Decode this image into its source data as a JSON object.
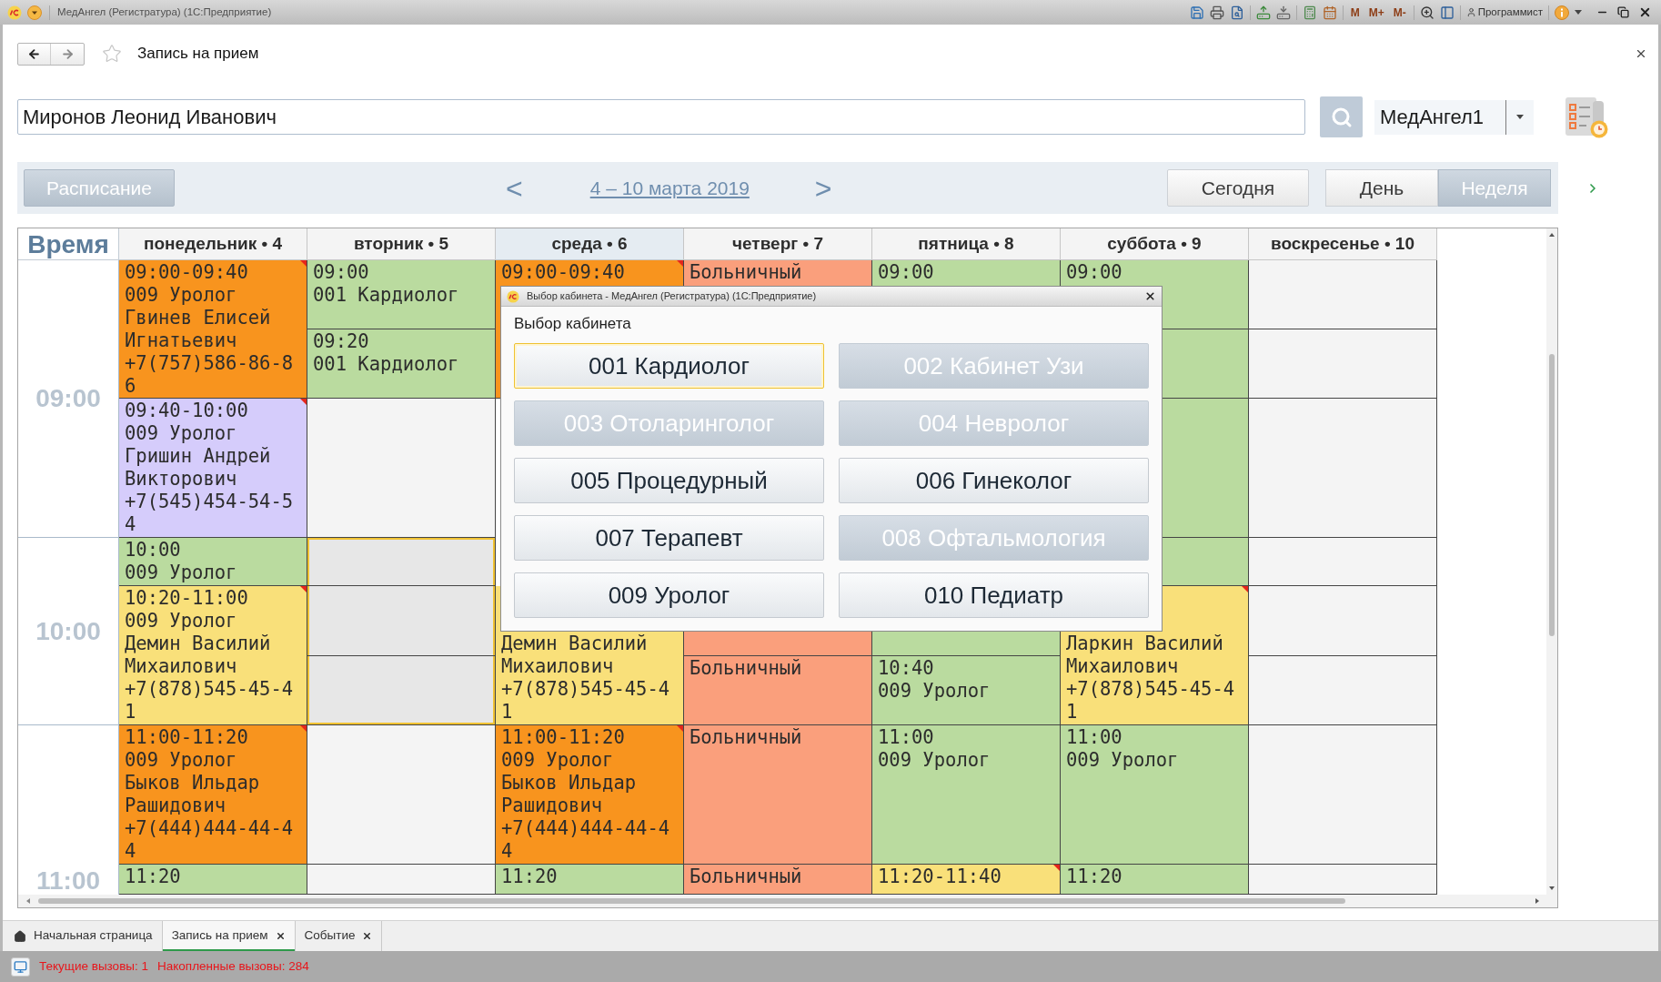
{
  "titlebar": {
    "title": "МедАнгел (Регистратура) (1С:Предприятие)",
    "memory_buttons": [
      "M",
      "M+",
      "M-"
    ],
    "user": "Программист"
  },
  "form": {
    "title": "Запись на прием",
    "favorite": false
  },
  "search": {
    "value": "Миронов Леонид Иванович"
  },
  "database": {
    "value": "МедАнгел1"
  },
  "toolbar": {
    "schedule_button": {
      "label": "Расписание",
      "pressed": true
    },
    "prev": "<",
    "period": "4 – 10 марта 2019",
    "next": ">",
    "today_button": {
      "label": "Сегодня",
      "pressed": false
    },
    "views": [
      {
        "label": "День",
        "selected": false
      },
      {
        "label": "Неделя",
        "selected": true
      }
    ]
  },
  "schedule": {
    "time_header": "Время",
    "hours": [
      "09:00",
      "10:00",
      "11:00"
    ],
    "days": [
      {
        "label": "понедельник • 4",
        "highlighted": false,
        "cells": [
          {
            "kind": "booked",
            "color": "#f8941e",
            "selected": false,
            "flagged": true,
            "time": "09:00-09:40",
            "room": "009 Уролог",
            "patient": "Гвинев Елисей Игнатьевич",
            "phone": "+7(757)586-86-86"
          },
          {
            "continues": true
          },
          {
            "kind": "booked",
            "color": "#d5ccfb",
            "selected": false,
            "flagged": true,
            "time": "09:40-10:00",
            "room": "009 Уролог",
            "patient": "Гришин Андрей Викторович",
            "phone": "+7(545)454-54-54"
          },
          {
            "kind": "booked",
            "color": "#badb9f",
            "selected": false,
            "flagged": false,
            "time": "10:00",
            "room": "009 Уролог"
          },
          {
            "kind": "booked",
            "color": "#f9e07a",
            "selected": false,
            "flagged": true,
            "time": "10:20-11:00",
            "room": "009 Уролог",
            "patient": "Демин Василий Михаилович",
            "phone": "+7(878)545-45-41"
          },
          {
            "continues": true
          },
          {
            "kind": "booked",
            "color": "#f8941e",
            "selected": false,
            "flagged": true,
            "time": "11:00-11:20",
            "room": "009 Уролог",
            "patient": "Быков Ильдар Рашидович",
            "phone": "+7(444)444-44-44"
          },
          {
            "kind": "booked",
            "color": "#badb9f",
            "selected": false,
            "flagged": false,
            "time": "11:20"
          }
        ]
      },
      {
        "label": "вторник • 5",
        "highlighted": false,
        "cells": [
          {
            "kind": "booked",
            "color": "#badb9f",
            "selected": false,
            "flagged": false,
            "time": "09:00",
            "room": "001 Кардиолог"
          },
          {
            "kind": "booked",
            "color": "#badb9f",
            "selected": false,
            "flagged": false,
            "time": "09:20",
            "room": "001 Кардиолог"
          },
          {
            "kind": "free",
            "selected": false
          },
          {
            "kind": "free",
            "selected": true
          },
          {
            "kind": "free",
            "selected": true
          },
          {
            "kind": "free",
            "selected": true
          },
          {
            "kind": "free",
            "selected": false
          },
          {
            "kind": "free",
            "selected": false
          }
        ]
      },
      {
        "label": "среда • 6",
        "highlighted": true,
        "cells": [
          {
            "kind": "booked",
            "color": "#f8941e",
            "selected": false,
            "flagged": true,
            "time": "09:00-09:40"
          },
          {
            "continues": true
          },
          null,
          null,
          {
            "kind": "booked",
            "color": "#f9e07a",
            "selected": false,
            "flagged": false,
            "covered_top": true,
            "patient": "Демин Василий Михаилович",
            "phone": "+7(878)545-45-41"
          },
          {
            "continues": true
          },
          {
            "kind": "booked",
            "color": "#f8941e",
            "selected": false,
            "flagged": true,
            "time": "11:00-11:20",
            "room": "009 Уролог",
            "patient": "Быков Ильдар Рашидович",
            "phone": "+7(444)444-44-44"
          },
          {
            "kind": "booked",
            "color": "#badb9f",
            "selected": false,
            "flagged": false,
            "time": "11:20"
          }
        ]
      },
      {
        "label": "четверг • 7",
        "highlighted": false,
        "cells": [
          {
            "kind": "booked",
            "color": "#fa9f7c",
            "selected": false,
            "flagged": false,
            "note": "Больничный"
          },
          null,
          null,
          null,
          {
            "kind": "booked",
            "color": "#fa9f7c",
            "selected": false,
            "flagged": false
          },
          {
            "kind": "booked",
            "color": "#fa9f7c",
            "selected": false,
            "flagged": false,
            "note": "Больничный"
          },
          {
            "kind": "booked",
            "color": "#fa9f7c",
            "selected": false,
            "flagged": false,
            "note": "Больничный"
          },
          {
            "kind": "booked",
            "color": "#fa9f7c",
            "selected": false,
            "flagged": false,
            "note": "Больничный"
          }
        ]
      },
      {
        "label": "пятница • 8",
        "highlighted": false,
        "cells": [
          {
            "kind": "booked",
            "color": "#badb9f",
            "selected": false,
            "flagged": false,
            "time": "09:00"
          },
          null,
          null,
          null,
          {
            "kind": "booked",
            "color": "#badb9f",
            "selected": false,
            "flagged": false
          },
          {
            "kind": "booked",
            "color": "#badb9f",
            "selected": false,
            "flagged": false,
            "time": "10:40",
            "room": "009 Уролог"
          },
          {
            "kind": "booked",
            "color": "#badb9f",
            "selected": false,
            "flagged": false,
            "time": "11:00",
            "room": "009 Уролог"
          },
          {
            "kind": "booked",
            "color": "#f9e07a",
            "selected": false,
            "flagged": true,
            "time": "11:20-11:40"
          }
        ]
      },
      {
        "label": "суббота • 9",
        "highlighted": false,
        "cells": [
          {
            "kind": "booked",
            "color": "#badb9f",
            "selected": false,
            "flagged": false,
            "time": "09:00"
          },
          {
            "kind": "booked",
            "color": "#badb9f",
            "selected": false,
            "flagged": false
          },
          {
            "kind": "booked",
            "color": "#badb9f",
            "selected": false,
            "flagged": false
          },
          {
            "kind": "booked",
            "color": "#badb9f",
            "selected": false,
            "flagged": false
          },
          {
            "kind": "booked",
            "color": "#f9e07a",
            "selected": false,
            "flagged": true,
            "covered_top": true,
            "patient": "Ларкин Василий Михаилович",
            "phone": "+7(878)545-45-41"
          },
          {
            "continues": true
          },
          {
            "kind": "booked",
            "color": "#badb9f",
            "selected": false,
            "flagged": false,
            "time": "11:00",
            "room": "009 Уролог"
          },
          {
            "kind": "booked",
            "color": "#badb9f",
            "selected": false,
            "flagged": false,
            "time": "11:20"
          }
        ]
      },
      {
        "label": "воскресенье • 10",
        "highlighted": false,
        "cells": [
          {
            "kind": "free",
            "selected": false
          },
          {
            "kind": "free",
            "selected": false
          },
          {
            "kind": "free",
            "selected": false
          },
          {
            "kind": "free",
            "selected": false
          },
          {
            "kind": "free",
            "selected": false
          },
          {
            "kind": "free",
            "selected": false
          },
          {
            "kind": "free",
            "selected": false
          },
          {
            "kind": "free",
            "selected": false
          }
        ]
      }
    ]
  },
  "dialog": {
    "title": "Выбор кабинета - МедАнгел (Регистратура) (1С:Предприятие)",
    "heading": "Выбор кабинета",
    "rooms": [
      {
        "label": "001 Кардиолог",
        "disabled": false,
        "focused": true
      },
      {
        "label": "002 Кабинет Узи",
        "disabled": true,
        "focused": false
      },
      {
        "label": "003 Отоларинголог",
        "disabled": true,
        "focused": false
      },
      {
        "label": "004 Невролог",
        "disabled": true,
        "focused": false
      },
      {
        "label": "005 Процедурный",
        "disabled": false,
        "focused": false
      },
      {
        "label": "006 Гинеколог",
        "disabled": false,
        "focused": false
      },
      {
        "label": "007 Терапевт",
        "disabled": false,
        "focused": false
      },
      {
        "label": "008 Офтальмология",
        "disabled": true,
        "focused": false
      },
      {
        "label": "009 Уролог",
        "disabled": false,
        "focused": false
      },
      {
        "label": "010 Педиатр",
        "disabled": false,
        "focused": false
      }
    ]
  },
  "tabs": [
    {
      "kind": "home",
      "label": "Начальная страница",
      "selected": false,
      "closable": false
    },
    {
      "kind": "page",
      "label": "Запись на прием",
      "selected": true,
      "closable": true
    },
    {
      "kind": "page",
      "label": "Событие",
      "selected": false,
      "closable": true
    }
  ],
  "status_bar": {
    "items": [
      "Текущие вызовы: 1",
      "Накопленные вызовы: 284"
    ]
  }
}
